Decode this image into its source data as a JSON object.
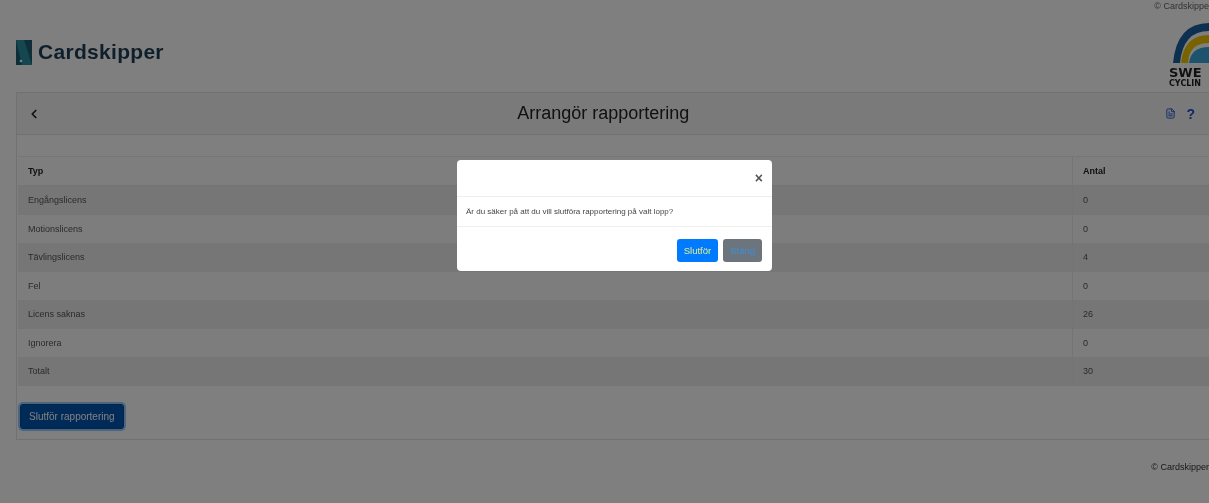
{
  "top_strip": {
    "copyright": "© Cardskippe"
  },
  "brand": {
    "name": "Cardskipper"
  },
  "partner_logo": {
    "line_1": "SWE",
    "line_2": "CYCLIN"
  },
  "card": {
    "title": "Arrangör rapportering",
    "help": "?"
  },
  "table": {
    "columns": [
      "Typ",
      "Antal"
    ],
    "rows": [
      {
        "type": "Engångslicens",
        "count": "0"
      },
      {
        "type": "Motionslicens",
        "count": "0"
      },
      {
        "type": "Tävlingslicens",
        "count": "4"
      },
      {
        "type": "Fel",
        "count": "0"
      },
      {
        "type": "Licens saknas",
        "count": "26"
      },
      {
        "type": "Ignorera",
        "count": "0"
      },
      {
        "type": "Totalt",
        "count": "30"
      }
    ]
  },
  "finish_button": "Slutför rapportering",
  "footer": "© Cardskipper",
  "dialog": {
    "close": "×",
    "message": "Är du säker på att du vill slutföra rapportering på valt lopp?",
    "buttons": [
      {
        "label": "Slutför",
        "kind": "primary"
      },
      {
        "label": "Stäng",
        "kind": "secondary"
      }
    ]
  }
}
